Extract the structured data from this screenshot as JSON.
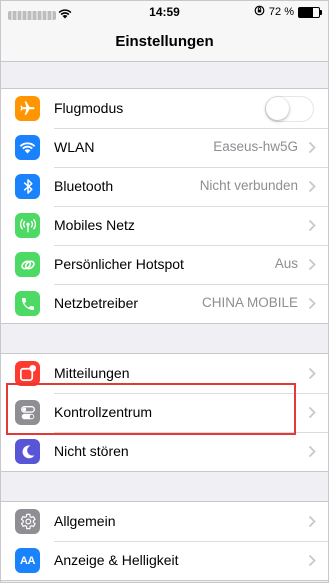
{
  "status_bar": {
    "time": "14:59",
    "battery": "72 %",
    "battery_fraction": 0.72
  },
  "nav": {
    "title": "Einstellungen"
  },
  "groups": [
    {
      "items": [
        {
          "label": "Flugmodus",
          "icon": "airplane-icon",
          "color": "#ff9500",
          "toggle_on": false
        },
        {
          "label": "WLAN",
          "value": "Easeus-hw5G",
          "icon": "wifi-icon",
          "color": "#1a82fb"
        },
        {
          "label": "Bluetooth",
          "value": "Nicht verbunden",
          "icon": "bluetooth-icon",
          "color": "#1a82fb"
        },
        {
          "label": "Mobiles Netz",
          "icon": "cellular-antenna-icon",
          "color": "#4cd964"
        },
        {
          "label": "Persönlicher Hotspot",
          "value": "Aus",
          "icon": "hotspot-chain-icon",
          "color": "#4cd964"
        },
        {
          "label": "Netzbetreiber",
          "value": "CHINA MOBILE",
          "icon": "phone-icon",
          "color": "#4cd964"
        }
      ]
    },
    {
      "items": [
        {
          "label": "Mitteilungen",
          "icon": "notifications-icon",
          "color": "#ff3b30"
        },
        {
          "label": "Kontrollzentrum",
          "icon": "control-center-icon",
          "color": "#8e8e93",
          "highlighted": true
        },
        {
          "label": "Nicht stören",
          "icon": "moon-icon",
          "color": "#5856d6"
        }
      ]
    },
    {
      "items": [
        {
          "label": "Allgemein",
          "icon": "gear-icon",
          "color": "#8e8e93"
        },
        {
          "label": "Anzeige & Helligkeit",
          "icon": "text-size-icon",
          "color": "#1a82fb",
          "icon_text": "AA"
        }
      ]
    }
  ]
}
